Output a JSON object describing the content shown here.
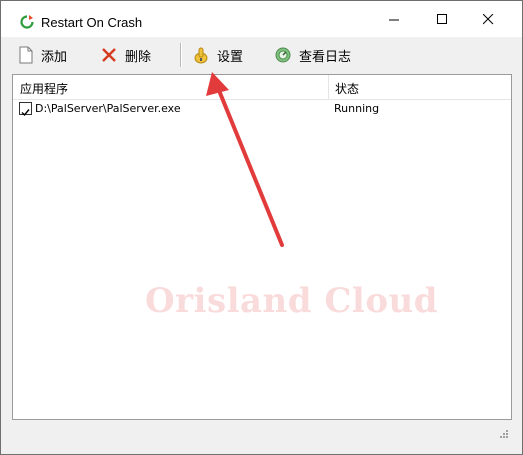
{
  "window": {
    "title": "Restart On Crash"
  },
  "toolbar": {
    "add_label": "添加",
    "delete_label": "删除",
    "settings_label": "设置",
    "log_label": "查看日志"
  },
  "list": {
    "columns": [
      "应用程序",
      "状态"
    ],
    "rows": [
      {
        "checked": true,
        "path": "D:\\PalServer\\PalServer.exe",
        "status": "Running"
      }
    ]
  },
  "watermark": "Orisland Cloud",
  "colors": {
    "arrow": "#e23b3b",
    "watermark": "#e66e6e"
  }
}
